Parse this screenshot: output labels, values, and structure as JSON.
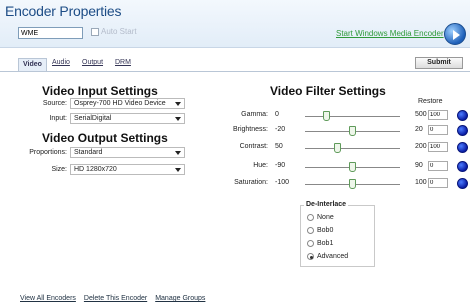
{
  "header": {
    "title": "Encoder Properties",
    "name_value": "WME",
    "autostart_label": "Auto Start",
    "start_link": "Start Windows Media Encoder",
    "logo_icon": "windows-media-encoder-icon"
  },
  "tabs": [
    "Video",
    "Audio",
    "Output",
    "DRM"
  ],
  "submit_label": "Submit",
  "input": {
    "heading": "Video Input Settings",
    "source_label": "Source:",
    "source_value": "Osprey-700 HD Video Device",
    "input_label": "Input:",
    "input_value": "SerialDigital"
  },
  "output": {
    "heading": "Video Output Settings",
    "proportions_label": "Proportions:",
    "proportions_value": "Standard",
    "size_label": "Size:",
    "size_value": "HD 1280x720"
  },
  "filters": {
    "heading": "Video Filter Settings",
    "restore_label": "Restore",
    "rows": [
      {
        "name": "Gamma:",
        "min": "0",
        "max": "500",
        "value": "100",
        "level": 0.2
      },
      {
        "name": "Brightness:",
        "min": "-20",
        "max": "20",
        "value": "0",
        "level": 0.5
      },
      {
        "name": "Contrast:",
        "min": "50",
        "max": "200",
        "value": "100",
        "level": 0.33
      },
      {
        "name": "Hue:",
        "min": "-90",
        "max": "90",
        "value": "0",
        "level": 0.5
      },
      {
        "name": "Saturation:",
        "min": "-100",
        "max": "100",
        "value": "0",
        "level": 0.5
      }
    ]
  },
  "deinterlace": {
    "legend": "De-Interlace",
    "options": [
      "None",
      "Bob0",
      "Bob1",
      "Advanced"
    ],
    "selected": "Advanced"
  },
  "footer": {
    "links": [
      "View All Encoders",
      "Delete This Encoder",
      "Manage Groups"
    ]
  },
  "colors": {
    "title": "#1d4d86",
    "start_link": "#2f9a3a",
    "restore": "#0b1ea6"
  }
}
